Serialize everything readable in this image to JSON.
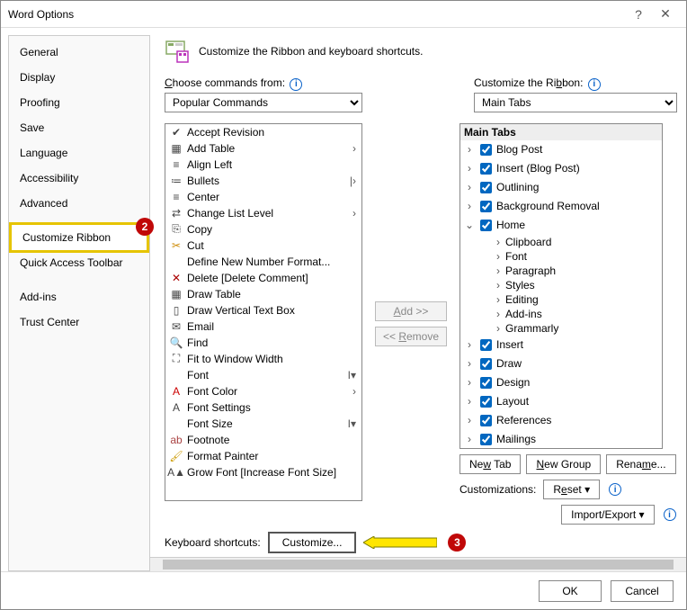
{
  "title": "Word Options",
  "heading": "Customize the Ribbon and keyboard shortcuts.",
  "sidebar": [
    "General",
    "Display",
    "Proofing",
    "Save",
    "Language",
    "Accessibility",
    "Advanced",
    "Customize Ribbon",
    "Quick Access Toolbar",
    "Add-ins",
    "Trust Center"
  ],
  "choose_from": {
    "label": "Choose commands from:",
    "value": "Popular Commands"
  },
  "customize": {
    "label": "Customize the Ribbon:",
    "value": "Main Tabs"
  },
  "commands": [
    {
      "label": "Accept Revision"
    },
    {
      "label": "Add Table"
    },
    {
      "label": "Align Left"
    },
    {
      "label": "Bullets"
    },
    {
      "label": "Center"
    },
    {
      "label": "Change List Level"
    },
    {
      "label": "Copy"
    },
    {
      "label": "Cut"
    },
    {
      "label": "Define New Number Format..."
    },
    {
      "label": "Delete [Delete Comment]"
    },
    {
      "label": "Draw Table"
    },
    {
      "label": "Draw Vertical Text Box"
    },
    {
      "label": "Email"
    },
    {
      "label": "Find"
    },
    {
      "label": "Fit to Window Width"
    },
    {
      "label": "Font"
    },
    {
      "label": "Font Color"
    },
    {
      "label": "Font Settings"
    },
    {
      "label": "Font Size"
    },
    {
      "label": "Footnote"
    },
    {
      "label": "Format Painter"
    },
    {
      "label": "Grow Font [Increase Font Size]"
    }
  ],
  "mid": {
    "add": "Add >>",
    "remove": "<< Remove"
  },
  "tree": {
    "header": "Main Tabs",
    "tabs": [
      "Blog Post",
      "Insert (Blog Post)",
      "Outlining",
      "Background Removal",
      "Home",
      "Insert",
      "Draw",
      "Design",
      "Layout",
      "References",
      "Mailings"
    ],
    "home_children": [
      "Clipboard",
      "Font",
      "Paragraph",
      "Styles",
      "Editing",
      "Add-ins",
      "Grammarly"
    ]
  },
  "tree_buttons": {
    "new_tab": "New Tab",
    "new_group": "New Group",
    "rename": "Rename..."
  },
  "customizations_label": "Customizations:",
  "reset_button": "Reset",
  "import_export_button": "Import/Export",
  "keyboard_label": "Keyboard shortcuts:",
  "customize_button": "Customize...",
  "footer": {
    "ok": "OK",
    "cancel": "Cancel"
  },
  "annotations": {
    "badge2": "2",
    "badge3": "3"
  }
}
